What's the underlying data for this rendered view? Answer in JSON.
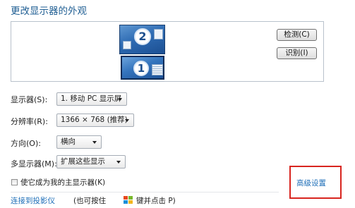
{
  "page_title": "更改显示器的外观",
  "preview": {
    "monitor_2_number": "2",
    "monitor_1_number": "1",
    "detect_label": "检测(C)",
    "identify_label": "识别(I)"
  },
  "settings": {
    "display": {
      "label": "显示器(S):",
      "value": "1. 移动 PC 显示屏"
    },
    "resolution": {
      "label": "分辨率(R):",
      "value": "1366 × 768 (推荐)"
    },
    "orientation": {
      "label": "方向(O):",
      "value": "横向"
    },
    "multiple_displays": {
      "label": "多显示器(M):",
      "value": "扩展这些显示"
    }
  },
  "main_display_checkbox": {
    "label": "使它成为我的主显示器(K)",
    "checked": false
  },
  "advanced_link": "高级设置",
  "footer": {
    "projector_link": "连接到投影仪",
    "hint_prefix": "(也可按住",
    "hint_suffix": "键并点击 P)"
  },
  "icons": {
    "windows_logo": "windows-logo-icon",
    "dropdown_arrow": "chevron-down-icon"
  },
  "colors": {
    "title_blue": "#1f5e93",
    "link_blue": "#1f6fb8",
    "highlight_red": "#d8251f",
    "monitor_blue": "#2e6bb3"
  }
}
